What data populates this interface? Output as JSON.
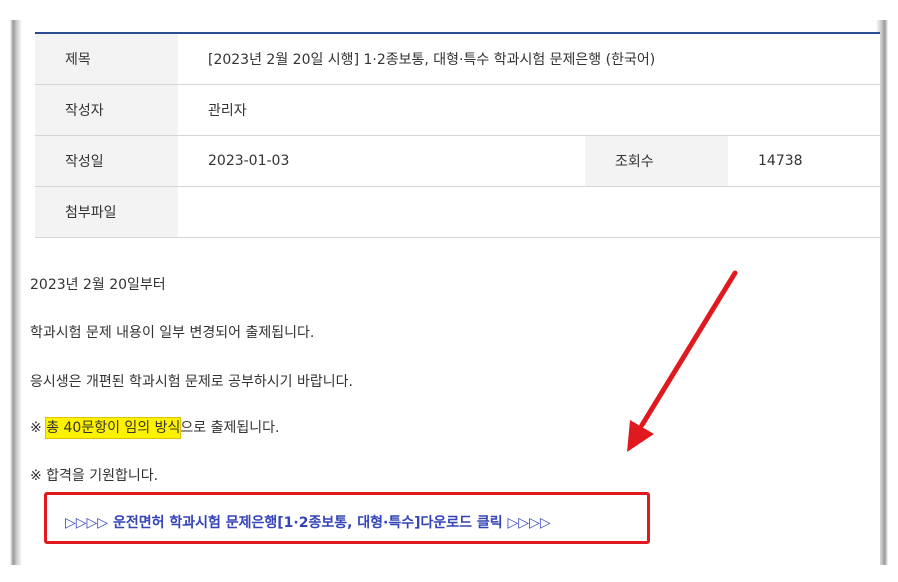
{
  "details": {
    "title_label": "제목",
    "title_value": "[2023년 2월 20일 시행] 1·2종보통, 대형·특수 학과시험 문제은행 (한국어)",
    "author_label": "작성자",
    "author_value": "관리자",
    "date_label": "작성일",
    "date_value": "2023-01-03",
    "views_label": "조회수",
    "views_value": "14738",
    "attachment_label": "첨부파일",
    "attachment_value": ""
  },
  "content": {
    "line1": "2023년 2월 20일부터",
    "line2": "학과시험 문제 내용이 일부 변경되어 출제됩니다.",
    "line3": "응시생은 개편된 학과시험 문제로 공부하시기 바랍니다.",
    "line4_prefix": "※ ",
    "line4_highlight": "총 40문항이 임의 방식",
    "line4_suffix": "으로 출제됩니다.",
    "line5": "※ 합격을 기원합니다.",
    "download_link": "▷▷▷▷ 운전면허 학과시험 문제은행[1·2종보통, 대형·특수]다운로드 클릭 ▷▷▷▷"
  },
  "colors": {
    "accent_line": "#2a4d8f",
    "link": "#3444b5",
    "highlight": "#fff200",
    "annotation_red": "#e0191e"
  }
}
